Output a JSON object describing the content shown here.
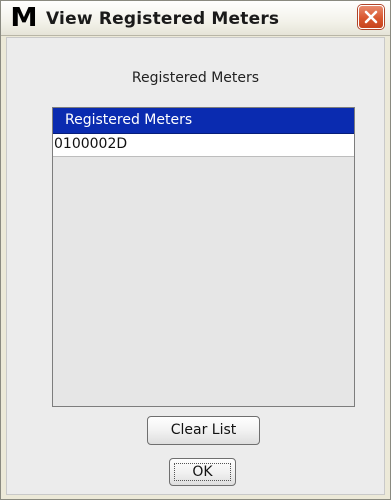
{
  "window": {
    "app_logo": "M",
    "title": "View Registered Meters"
  },
  "dialog": {
    "heading": "Registered Meters",
    "table": {
      "column_header": "Registered Meters",
      "rows": [
        "0100002D"
      ]
    },
    "clear_button": "Clear List",
    "ok_button": "OK"
  },
  "icons": {
    "close": "close-icon",
    "logo": "app-logo"
  },
  "colors": {
    "header_bg": "#0a2bb0",
    "close_button": "#d9572f"
  }
}
